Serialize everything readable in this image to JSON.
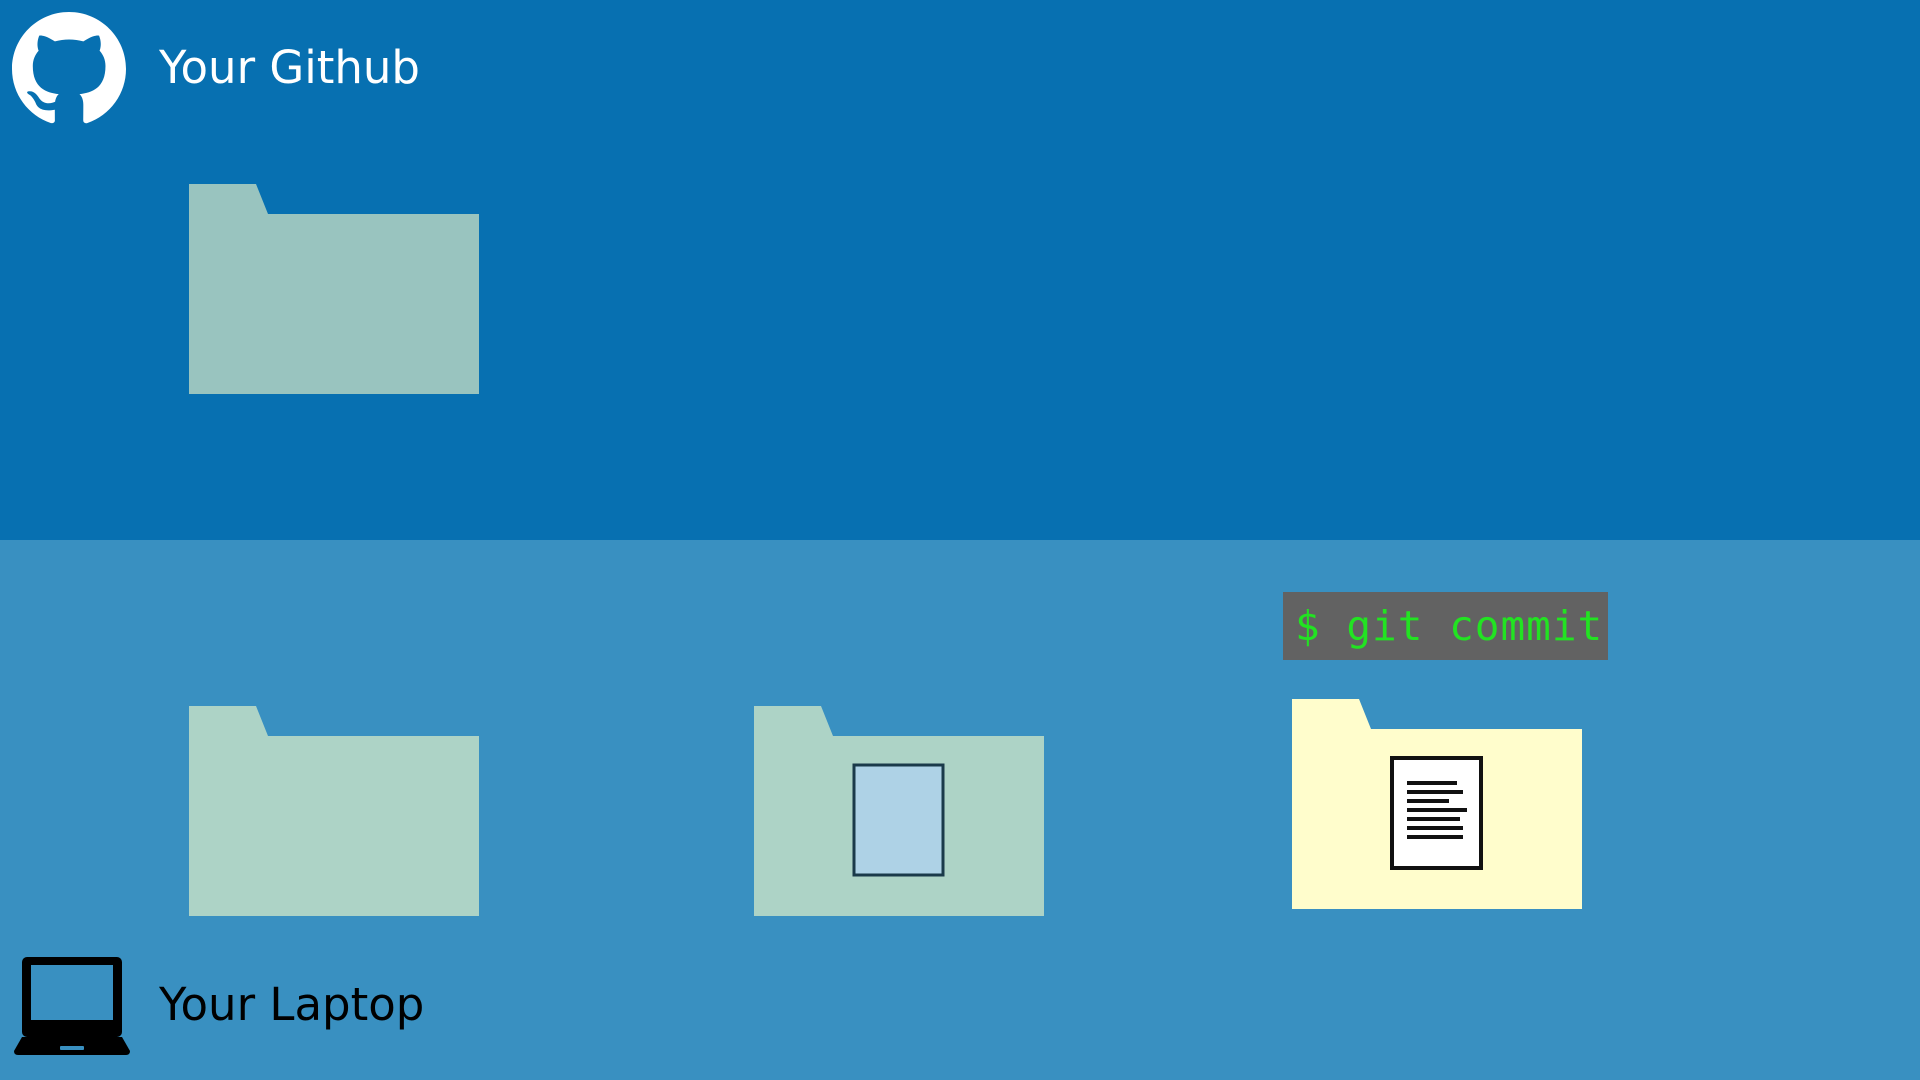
{
  "remote": {
    "label": "Your Github",
    "icon": "github-icon",
    "background": "#0770b1"
  },
  "local": {
    "label": "Your Laptop",
    "icon": "laptop-icon",
    "background": "#3990c1"
  },
  "command": {
    "text": "$ git commit",
    "background": "#626262",
    "color": "#22e322"
  },
  "folders": [
    {
      "id": "remote-repository",
      "color": "#99c4bf",
      "contains": "none"
    },
    {
      "id": "working-directory",
      "color": "#add3c6",
      "contains": "none"
    },
    {
      "id": "staging-area",
      "color": "#add3c6",
      "contains": "blank-file"
    },
    {
      "id": "local-repository",
      "color": "#fffdcc",
      "contains": "text-document"
    }
  ],
  "colors": {
    "blank_file_fill": "#aed2e6",
    "blank_file_stroke": "#1a3a4a",
    "document_fill": "#ffffff",
    "document_stroke": "#111111"
  }
}
